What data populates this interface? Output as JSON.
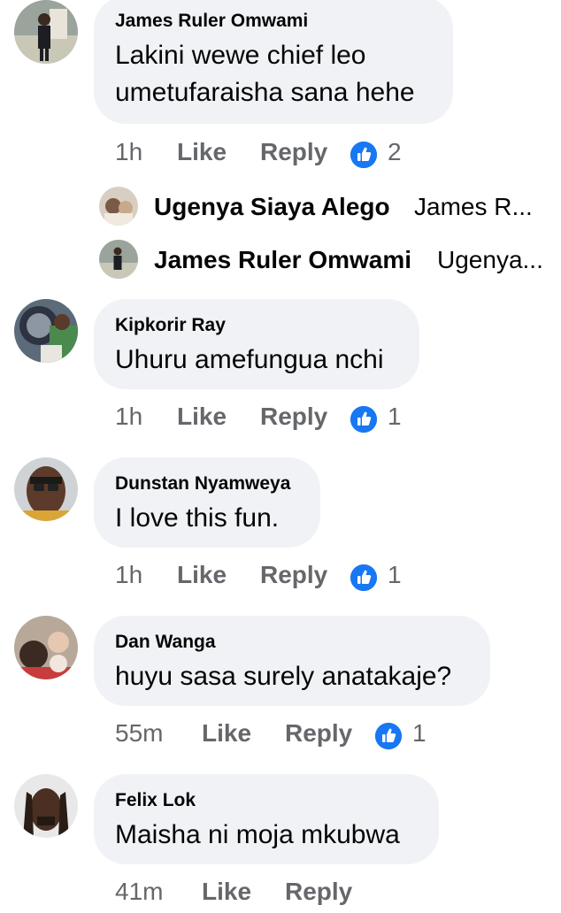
{
  "comments": [
    {
      "author": "James Ruler Omwami",
      "text_line1": "Lakini wewe chief leo",
      "text_line2": "umetufaraisha sana hehe",
      "time": "1h",
      "like_label": "Like",
      "reply_label": "Reply",
      "reactions": "2",
      "replies": [
        {
          "author": "Ugenya Siaya Alego",
          "snippet": "James R..."
        },
        {
          "author": "James Ruler Omwami",
          "snippet": "Ugenya..."
        }
      ]
    },
    {
      "author": "Kipkorir Ray",
      "text_line1": "Uhuru amefungua nchi",
      "time": "1h",
      "like_label": "Like",
      "reply_label": "Reply",
      "reactions": "1"
    },
    {
      "author": "Dunstan Nyamweya",
      "text_line1": "I love this fun.",
      "time": "1h",
      "like_label": "Like",
      "reply_label": "Reply",
      "reactions": "1"
    },
    {
      "author": "Dan Wanga",
      "text_line1": "huyu sasa surely anatakaje?",
      "time": "55m",
      "like_label": "Like",
      "reply_label": "Reply",
      "reactions": "1"
    },
    {
      "author": "Felix Lok",
      "text_line1": "Maisha ni moja mkubwa",
      "time": "41m",
      "like_label": "Like",
      "reply_label": "Reply"
    }
  ],
  "colors": {
    "bubble": "#f0f2f5",
    "meta_text": "#65676b",
    "like_blue": "#1877f2"
  },
  "icons": {
    "reaction": "thumbs-up-icon"
  }
}
